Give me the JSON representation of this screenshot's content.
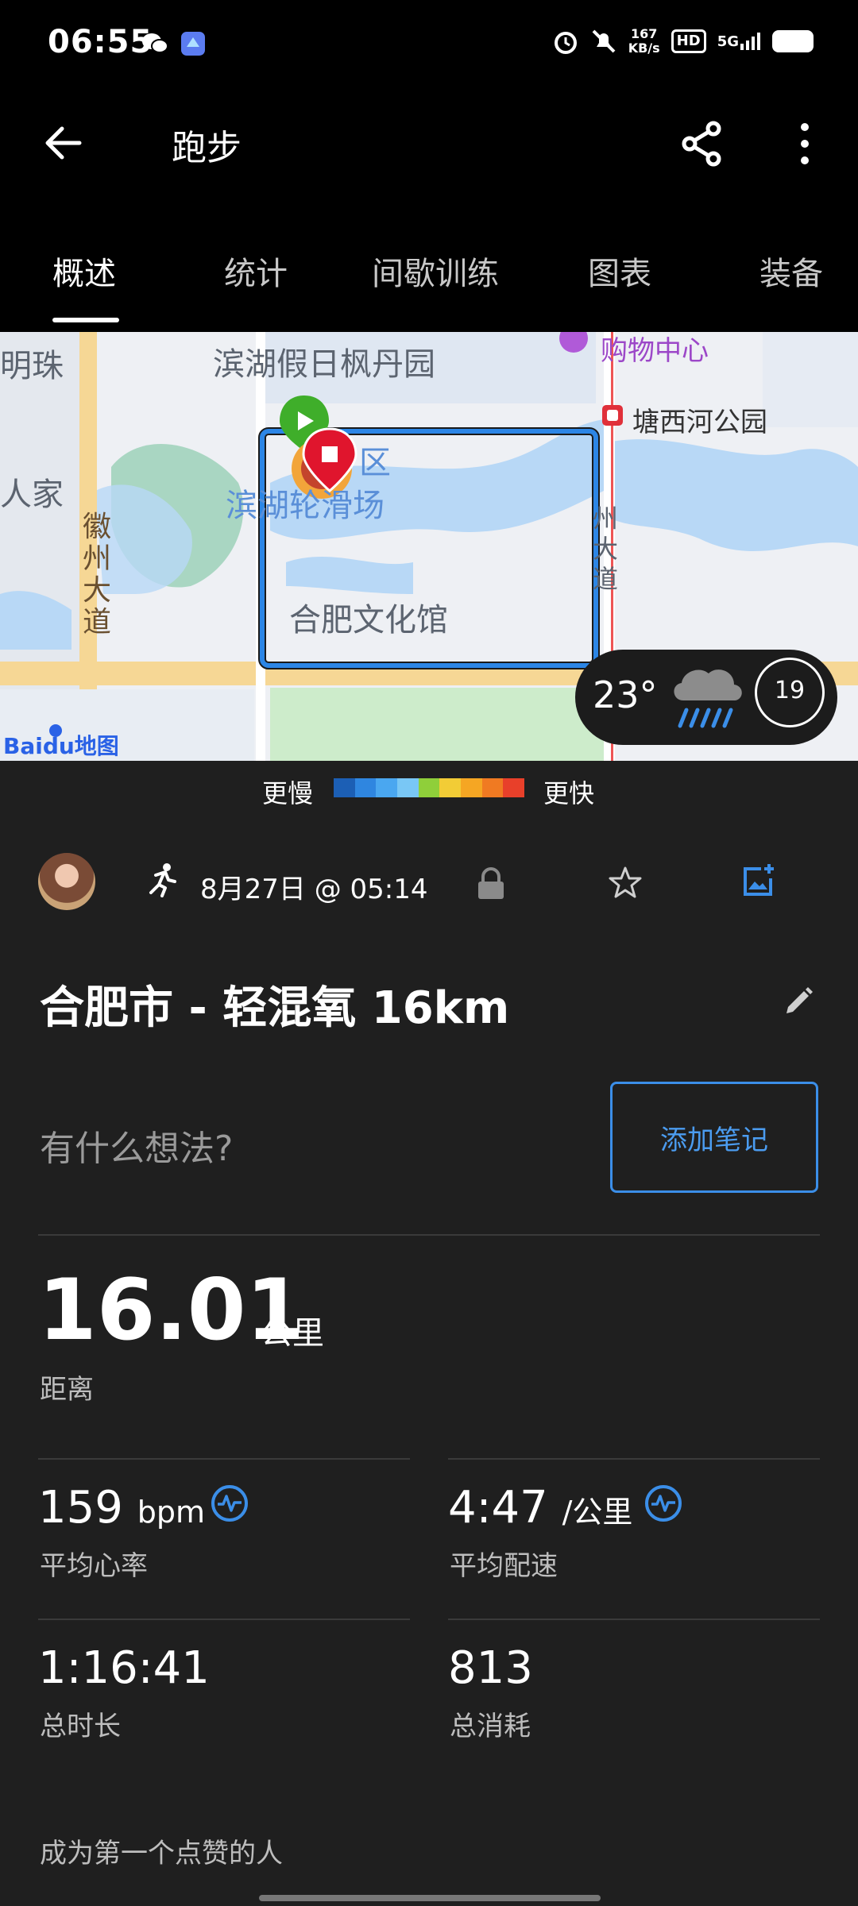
{
  "status_bar": {
    "time": "06:55",
    "net_speed_value": "167",
    "net_speed_unit": "KB/s",
    "hd": "HD",
    "signal": "5G",
    "icons": [
      "wechat-icon",
      "app-icon",
      "alarm-icon",
      "mute-icon",
      "hd-icon",
      "signal-5g-icon",
      "battery-icon"
    ]
  },
  "header": {
    "title": "跑步",
    "icons": [
      "back-arrow-icon",
      "share-icon",
      "more-vert-icon"
    ]
  },
  "tabs": [
    {
      "label": "概述",
      "active": true
    },
    {
      "label": "统计",
      "active": false
    },
    {
      "label": "间歇训练",
      "active": false
    },
    {
      "label": "图表",
      "active": false
    },
    {
      "label": "装备",
      "active": false
    }
  ],
  "map": {
    "labels": {
      "mingzhu": "明珠",
      "binhu_garden": "滨湖假日枫丹园",
      "shopping": "购物中心",
      "tangxi_park": "塘西河公园",
      "renjia": "人家",
      "qu": "区",
      "skating": "滨湖轮滑场",
      "huizhou_road": "徽州大道",
      "culture_hall": "合肥文化馆",
      "road_right": "州大道"
    },
    "logo": "Baidu地图",
    "weather": {
      "temperature": "23°",
      "hour": "19",
      "icon": "rain-cloud-icon"
    }
  },
  "pace_legend": {
    "slow": "更慢",
    "fast": "更快",
    "colors": [
      "#1c5fb5",
      "#2f86e0",
      "#4aa7f0",
      "#79c7f5",
      "#8fcf3a",
      "#f2cc36",
      "#f5a623",
      "#f07a22",
      "#e8402a"
    ]
  },
  "activity": {
    "date": "8月27日 @ 05:14",
    "name": "合肥市 - 轻混氧 16km",
    "thoughts_placeholder": "有什么想法?",
    "add_note_label": "添加笔记",
    "accent": "#3b8ee8"
  },
  "stats": {
    "distance": {
      "value": "16.01",
      "unit": "公里",
      "label": "距离"
    },
    "heart_rate": {
      "value": "159",
      "unit": "bpm",
      "label": "平均心率"
    },
    "pace": {
      "value": "4:47",
      "unit": "/公里",
      "label": "平均配速"
    },
    "duration": {
      "value": "1:16:41",
      "label": "总时长"
    },
    "calories": {
      "value": "813",
      "label": "总消耗"
    }
  },
  "kudos_text": "成为第一个点赞的人"
}
